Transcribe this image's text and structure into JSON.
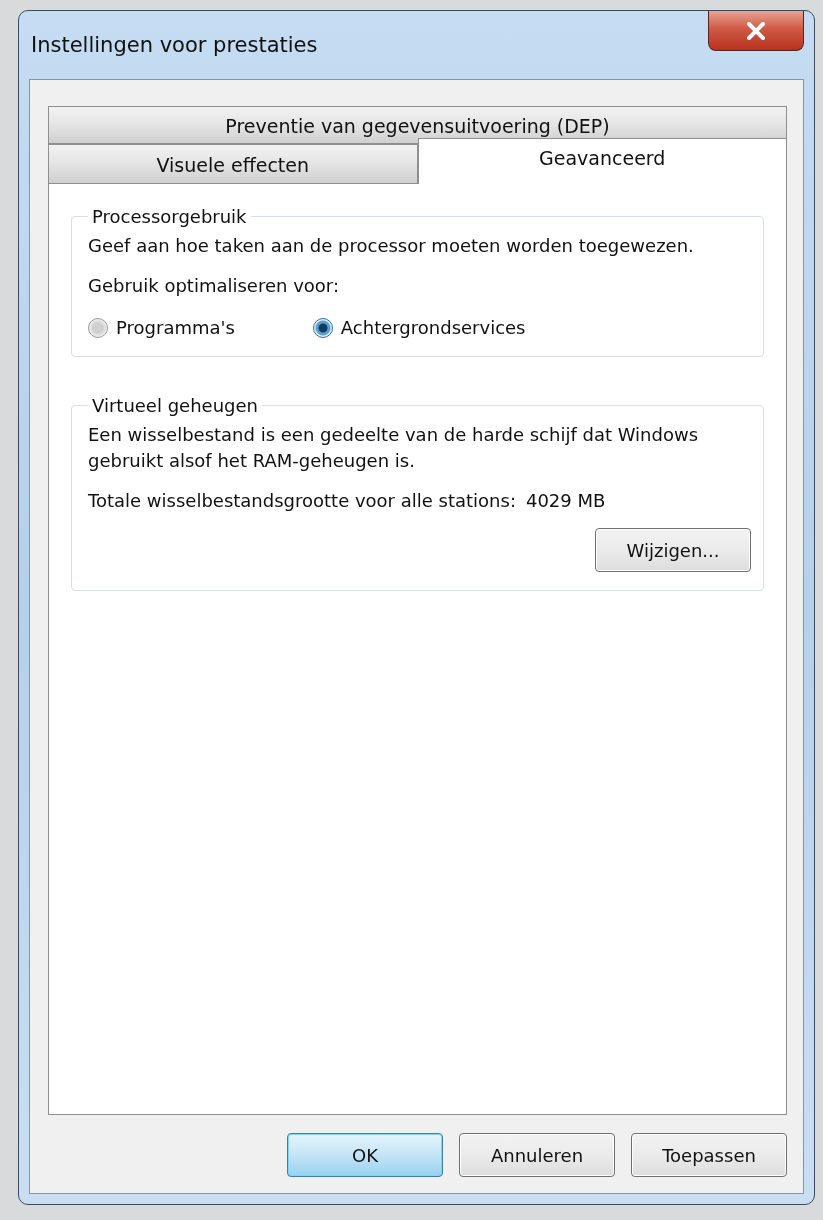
{
  "window": {
    "title": "Instellingen voor prestaties"
  },
  "tab_rows": [
    [
      {
        "label": "Preventie van gegevensuitvoering (DEP)",
        "selected": false
      }
    ],
    [
      {
        "label": "Visuele effecten",
        "selected": false
      },
      {
        "label": "Geavanceerd",
        "selected": true
      }
    ]
  ],
  "processor_group": {
    "title": "Processorgebruik",
    "description": "Geef aan hoe taken aan de processor moeten worden toegewezen.",
    "prompt": "Gebruik optimaliseren voor:",
    "options": [
      {
        "label": "Programma's",
        "selected": false
      },
      {
        "label": "Achtergrondservices",
        "selected": true
      }
    ]
  },
  "memory_group": {
    "title": "Virtueel geheugen",
    "description": "Een wisselbestand is een gedeelte van de harde schijf dat Windows gebruikt alsof het RAM-geheugen is.",
    "total_label": "Totale wisselbestandsgrootte voor alle stations:",
    "total_value": "4029 MB",
    "button": "Wijzigen..."
  },
  "buttons": [
    {
      "label": "OK",
      "default": true
    },
    {
      "label": "Annuleren",
      "default": false
    },
    {
      "label": "Toepassen",
      "default": false
    }
  ]
}
